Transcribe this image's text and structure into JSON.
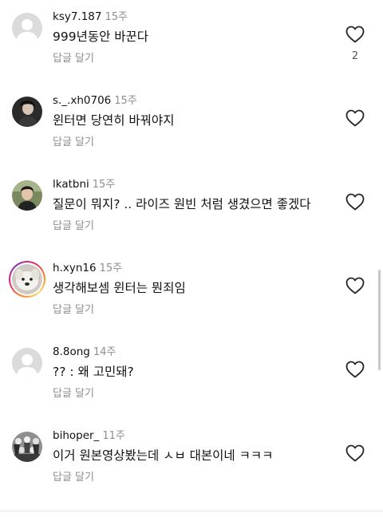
{
  "comments": [
    {
      "username": "ksy7.187",
      "time": "15주",
      "text": "999년동안  바꾼다",
      "reply": "답글 달기",
      "likes": "2",
      "avatar": "default-avatar"
    },
    {
      "username": "s._.xh0706",
      "time": "15주",
      "text": "윈터면 당연히 바꿔야지",
      "reply": "답글 달기",
      "avatar": "photo-avatar"
    },
    {
      "username": "lkatbni",
      "time": "15주",
      "text": "질문이 뭐지? .. 라이즈 원빈 처럼 생겼으면 좋겠다",
      "reply": "답글 달기",
      "avatar": "photo-avatar"
    },
    {
      "username": "h.xyn16",
      "time": "15주",
      "text": "생각해보셈 윈터는 뭔죄임",
      "reply": "답글 달기",
      "avatar": "story-ring-photo-avatar"
    },
    {
      "username": "8.8ong",
      "time": "14주",
      "text": "?? : 왜 고민돼?",
      "reply": "답글 달기",
      "avatar": "default-avatar"
    },
    {
      "username": "bihoper_",
      "time": "11주",
      "text": "이거 원본영상봤는데 ㅅㅂ 대본이네 ㅋㅋㅋ",
      "reply": "답글 달기",
      "avatar": "photo-avatar"
    }
  ],
  "colors": {
    "text": "#111111",
    "secondary": "#8e8e8e",
    "heart_outline": "#262626"
  }
}
